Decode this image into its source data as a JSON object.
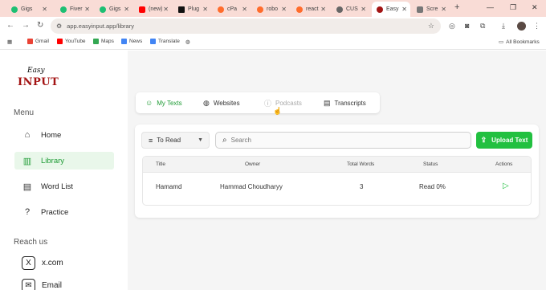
{
  "browser": {
    "tabs": [
      {
        "label": "Gigs",
        "fav_color": "#1dbf73"
      },
      {
        "label": "Fiver",
        "fav_color": "#1dbf73"
      },
      {
        "label": "Gigs",
        "fav_color": "#1dbf73"
      },
      {
        "label": "(new)",
        "fav_color": "#ff0000"
      },
      {
        "label": "Plug",
        "fav_color": "#111111"
      },
      {
        "label": "cPa",
        "fav_color": "#ff6c2c"
      },
      {
        "label": "robo",
        "fav_color": "#ff6c2c"
      },
      {
        "label": "react",
        "fav_color": "#ff6c2c"
      },
      {
        "label": "CUS",
        "fav_color": "#666666"
      },
      {
        "label": "Easy",
        "fav_color": "#a31414"
      },
      {
        "label": "Scre",
        "fav_color": "#777777"
      }
    ],
    "url": "app.easyinput.app/library",
    "bookmarks": [
      {
        "label": "Gmail",
        "color": "#ea4335"
      },
      {
        "label": "YouTube",
        "color": "#ff0000"
      },
      {
        "label": "Maps",
        "color": "#34a853"
      },
      {
        "label": "News",
        "color": "#4285f4"
      },
      {
        "label": "Translate",
        "color": "#4285f4"
      }
    ],
    "all_bookmarks": "All Bookmarks"
  },
  "logo": {
    "line1": "Easy",
    "line2": "INPUT"
  },
  "sidebar": {
    "menu_title": "Menu",
    "items": [
      {
        "label": "Home",
        "icon": "home-icon"
      },
      {
        "label": "Library",
        "icon": "library-icon",
        "active": true
      },
      {
        "label": "Word List",
        "icon": "book-icon"
      },
      {
        "label": "Practice",
        "icon": "question-icon"
      }
    ],
    "reach_title": "Reach us",
    "socials": [
      {
        "label": "x.com",
        "icon": "x-icon"
      },
      {
        "label": "Email",
        "icon": "mail-icon"
      }
    ]
  },
  "content_tabs": [
    {
      "label": "My Texts",
      "state": "active"
    },
    {
      "label": "Websites",
      "state": "normal"
    },
    {
      "label": "Podcasts",
      "state": "disabled"
    },
    {
      "label": "Transcripts",
      "state": "normal"
    }
  ],
  "toolbar": {
    "filter_label": "To Read",
    "search_placeholder": "Search",
    "upload_label": "Upload Text"
  },
  "table": {
    "columns": [
      "Title",
      "Owner",
      "Total Words",
      "Status",
      "Actions"
    ],
    "rows": [
      {
        "title": "Hamamd",
        "owner": "Hammad Choudharyy",
        "total_words": "3",
        "status": "Read 0%"
      }
    ]
  },
  "colors": {
    "accent": "#22c040",
    "brand": "#a31414"
  }
}
